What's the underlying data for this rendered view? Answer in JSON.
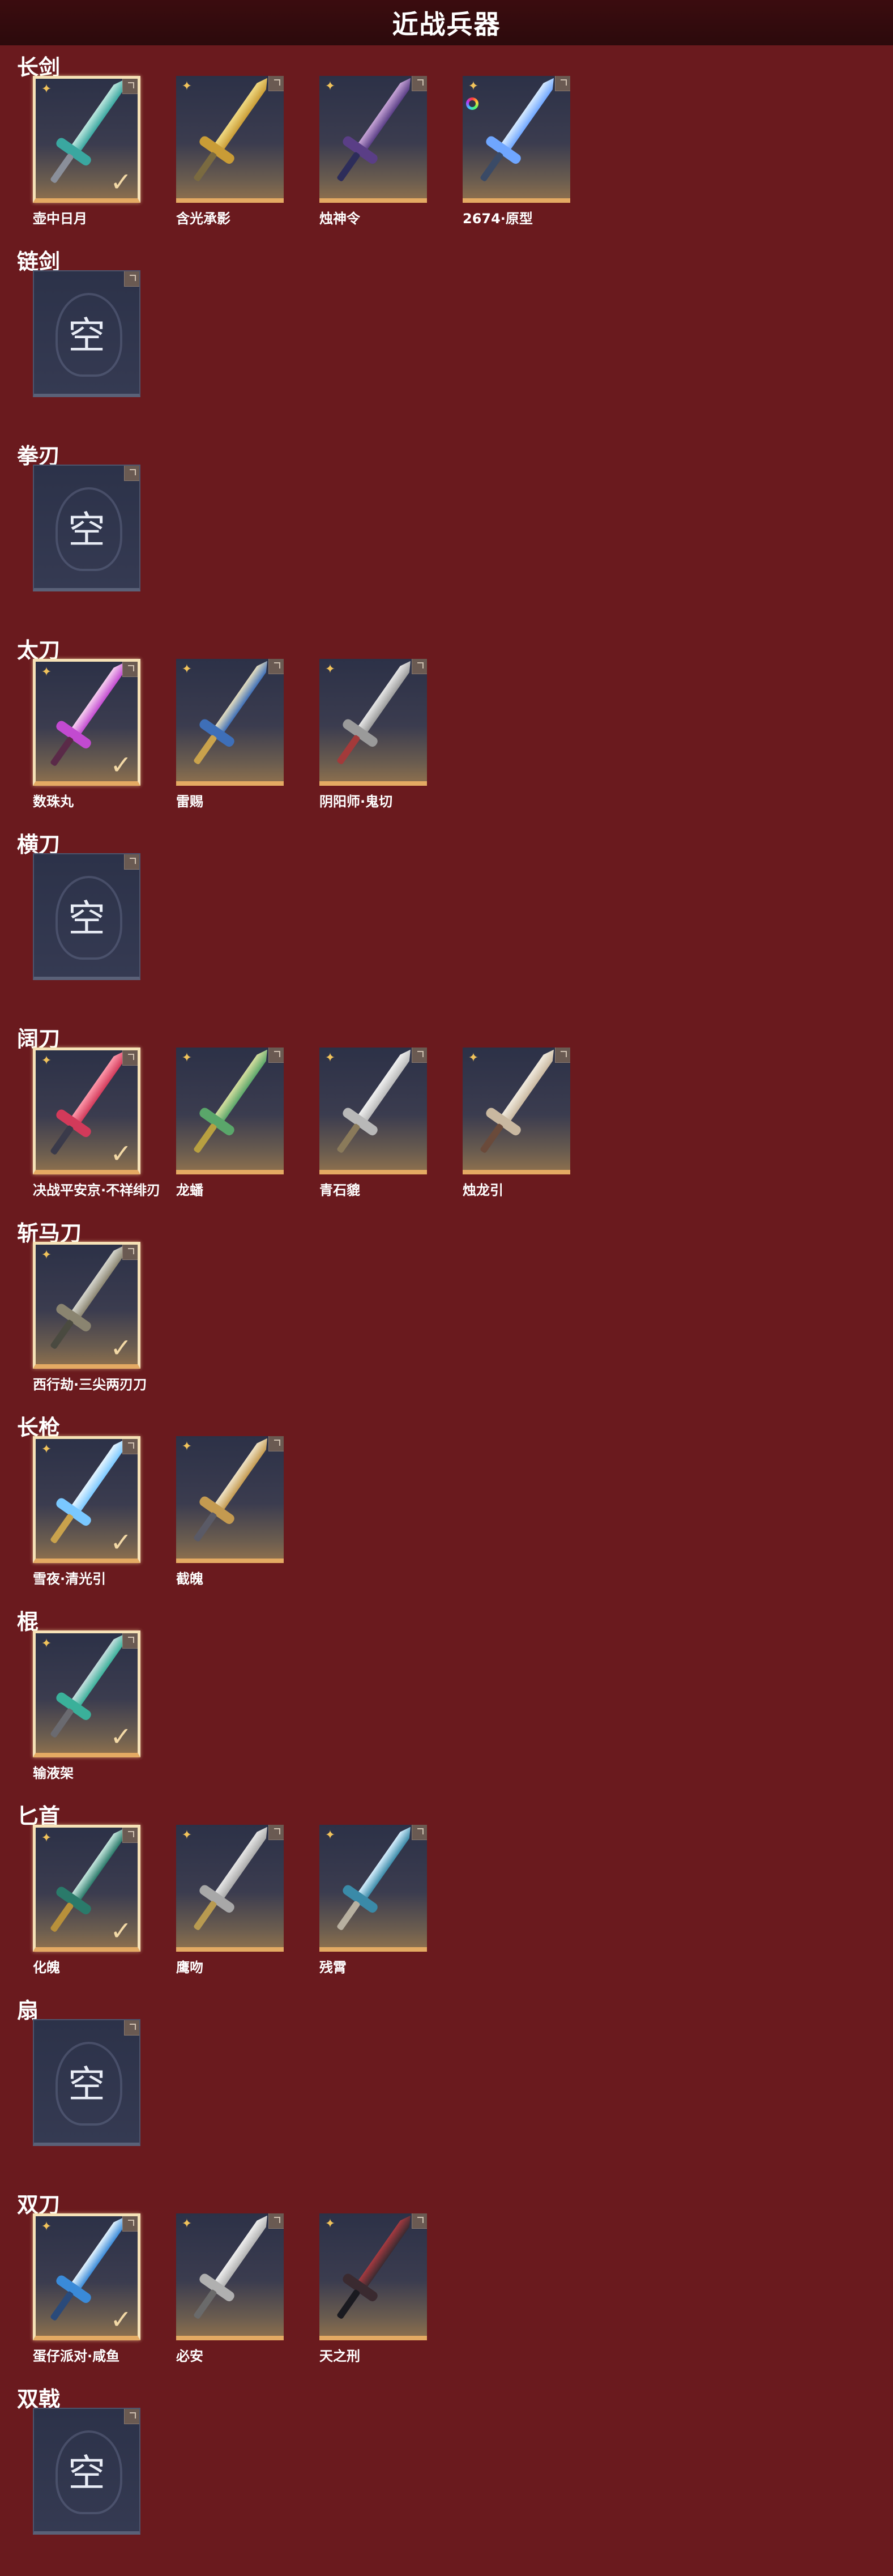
{
  "header": {
    "title": "近战兵器"
  },
  "empty_label": "空",
  "sections": [
    {
      "title": "长剑",
      "items": [
        {
          "name": "壶中日月",
          "owned": true,
          "empty": false,
          "colors": [
            "#bfe8e0",
            "#3aa7a0",
            "#8a8f9a"
          ]
        },
        {
          "name": "含光承影",
          "owned": false,
          "empty": false,
          "colors": [
            "#f1db84",
            "#c99c36",
            "#7a6a40"
          ]
        },
        {
          "name": "烛神令",
          "owned": false,
          "empty": false,
          "colors": [
            "#c9a6d8",
            "#5a3e86",
            "#2d2d5a"
          ]
        },
        {
          "name": "2674·原型",
          "owned": false,
          "empty": false,
          "colors": [
            "#d9ecff",
            "#6fa6ff",
            "#3a4a66"
          ],
          "ring": true
        }
      ]
    },
    {
      "title": "链剑",
      "items": [
        {
          "name": "",
          "owned": false,
          "empty": true
        }
      ]
    },
    {
      "title": "拳刃",
      "items": [
        {
          "name": "",
          "owned": false,
          "empty": true
        }
      ]
    },
    {
      "title": "太刀",
      "items": [
        {
          "name": "数珠丸",
          "owned": true,
          "empty": false,
          "colors": [
            "#f7d1f0",
            "#c24ad0",
            "#5a2a48"
          ]
        },
        {
          "name": "雷赐",
          "owned": false,
          "empty": false,
          "colors": [
            "#e8e0c0",
            "#3e6fb8",
            "#c9a24c"
          ]
        },
        {
          "name": "阴阳师·鬼切",
          "owned": false,
          "empty": false,
          "colors": [
            "#e8e8e8",
            "#9a9a9a",
            "#a33a3a"
          ]
        }
      ]
    },
    {
      "title": "横刀",
      "items": [
        {
          "name": "",
          "owned": false,
          "empty": true
        }
      ]
    },
    {
      "title": "阔刀",
      "items": [
        {
          "name": "决战平安京·不祥绯刃",
          "owned": true,
          "empty": false,
          "colors": [
            "#ff9aac",
            "#d23a5a",
            "#3a3a4a"
          ]
        },
        {
          "name": "龙蟠",
          "owned": false,
          "empty": false,
          "colors": [
            "#d8e0a0",
            "#5aa66a",
            "#b8a040"
          ]
        },
        {
          "name": "青石貔",
          "owned": false,
          "empty": false,
          "colors": [
            "#f2f2f2",
            "#b8b8b8",
            "#8a7a5a"
          ]
        },
        {
          "name": "烛龙引",
          "owned": false,
          "empty": false,
          "colors": [
            "#f2ece0",
            "#c9b8a0",
            "#6a4a3a"
          ]
        }
      ]
    },
    {
      "title": "斩马刀",
      "items": [
        {
          "name": "西行劫·三尖两刃刀",
          "owned": true,
          "empty": false,
          "colors": [
            "#d8d8d0",
            "#8a8470",
            "#4a4a40"
          ]
        }
      ]
    },
    {
      "title": "长枪",
      "items": [
        {
          "name": "雪夜·清光引",
          "owned": true,
          "empty": false,
          "colors": [
            "#e8f6ff",
            "#7ac8ff",
            "#c9a24c"
          ]
        },
        {
          "name": "截魄",
          "owned": false,
          "empty": false,
          "colors": [
            "#f0e4c8",
            "#c49a50",
            "#5a5a66"
          ]
        }
      ]
    },
    {
      "title": "棍",
      "items": [
        {
          "name": "输液架",
          "owned": true,
          "empty": false,
          "colors": [
            "#c8e0e0",
            "#3ab09a",
            "#6a6a70"
          ]
        }
      ]
    },
    {
      "title": "匕首",
      "items": [
        {
          "name": "化魄",
          "owned": true,
          "empty": false,
          "colors": [
            "#c8e8e0",
            "#2a7a6a",
            "#b8903a"
          ]
        },
        {
          "name": "鹰吻",
          "owned": false,
          "empty": false,
          "colors": [
            "#e8e8e8",
            "#a8a8a8",
            "#b89a50"
          ]
        },
        {
          "name": "残霄",
          "owned": false,
          "empty": false,
          "colors": [
            "#d8f0ff",
            "#3a8aa8",
            "#b8b0a0"
          ]
        }
      ]
    },
    {
      "title": "扇",
      "items": [
        {
          "name": "",
          "owned": false,
          "empty": true
        }
      ]
    },
    {
      "title": "双刀",
      "items": [
        {
          "name": "蛋仔派对·咸鱼",
          "owned": true,
          "empty": false,
          "colors": [
            "#e8f6ff",
            "#3a8ad8",
            "#2a4a7a"
          ]
        },
        {
          "name": "必安",
          "owned": false,
          "empty": false,
          "colors": [
            "#f0f0f0",
            "#b0b0b0",
            "#6a6a6a"
          ]
        },
        {
          "name": "天之刑",
          "owned": false,
          "empty": false,
          "colors": [
            "#a83a40",
            "#3a2a30",
            "#1a1a20"
          ]
        }
      ]
    },
    {
      "title": "双戟",
      "items": [
        {
          "name": "",
          "owned": false,
          "empty": true
        }
      ]
    }
  ]
}
